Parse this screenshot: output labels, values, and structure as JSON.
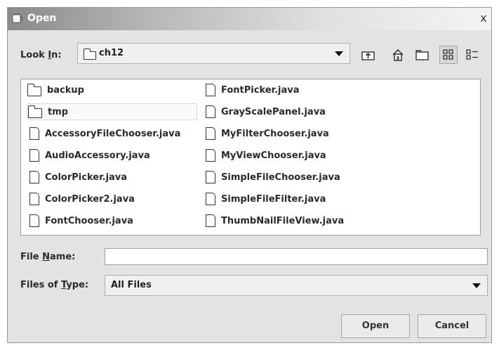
{
  "window": {
    "title": "Open",
    "close_glyph": "x"
  },
  "look_in": {
    "label_pre": "Look ",
    "label_mn": "I",
    "label_post": "n:",
    "value": "ch12"
  },
  "toolbar": {
    "icons": [
      "up-one-level-icon",
      "home-icon",
      "new-folder-icon",
      "list-view-icon",
      "details-view-icon"
    ]
  },
  "files": {
    "column1": [
      {
        "name": "backup",
        "type": "folder"
      },
      {
        "name": "tmp",
        "type": "folder",
        "selected": true
      },
      {
        "name": "AccessoryFileChooser.java",
        "type": "file"
      },
      {
        "name": "AudioAccessory.java",
        "type": "file"
      },
      {
        "name": "ColorPicker.java",
        "type": "file"
      },
      {
        "name": "ColorPicker2.java",
        "type": "file"
      },
      {
        "name": "FontChooser.java",
        "type": "file"
      }
    ],
    "column2": [
      {
        "name": "FontPicker.java",
        "type": "file"
      },
      {
        "name": "GrayScalePanel.java",
        "type": "file"
      },
      {
        "name": "MyFilterChooser.java",
        "type": "file"
      },
      {
        "name": "MyViewChooser.java",
        "type": "file"
      },
      {
        "name": "SimpleFileChooser.java",
        "type": "file"
      },
      {
        "name": "SimpleFileFilter.java",
        "type": "file"
      },
      {
        "name": "ThumbNailFileView.java",
        "type": "file"
      }
    ]
  },
  "file_name": {
    "label_pre": "File ",
    "label_mn": "N",
    "label_post": "ame:",
    "value": ""
  },
  "file_type": {
    "label_pre": "Files of ",
    "label_mn": "T",
    "label_post": "ype:",
    "value": "All Files"
  },
  "buttons": {
    "open": "Open",
    "cancel": "Cancel"
  }
}
